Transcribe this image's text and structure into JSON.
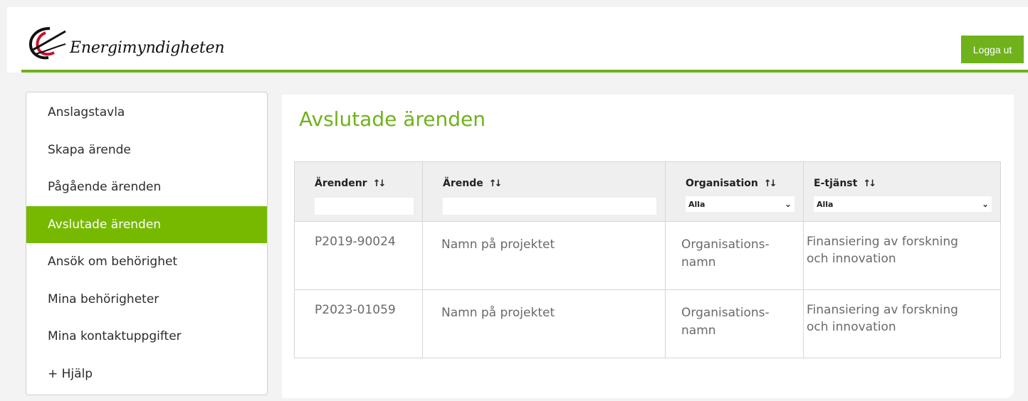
{
  "header": {
    "logo_text": "Energimyndigheten",
    "logout_label": "Logga ut"
  },
  "sidebar": {
    "items": [
      {
        "label": "Anslagstavla"
      },
      {
        "label": "Skapa ärende"
      },
      {
        "label": "Pågående ärenden"
      },
      {
        "label": "Avslutade ärenden",
        "active": true
      },
      {
        "label": "Ansök om behörighet"
      },
      {
        "label": "Mina behörigheter"
      },
      {
        "label": "Mina kontaktuppgifter"
      },
      {
        "label": "+ Hjälp"
      }
    ]
  },
  "main": {
    "title": "Avslutade ärenden",
    "table": {
      "columns": [
        {
          "label": "Ärendenr",
          "filter": ""
        },
        {
          "label": "Ärende",
          "filter": ""
        },
        {
          "label": "Organisation",
          "filter": "Alla"
        },
        {
          "label": "E-tjänst",
          "filter": "Alla"
        }
      ],
      "rows": [
        {
          "nr": "P2019-90024",
          "name": "Namn på projektet",
          "org": "Organisations-namn",
          "tjanst": "Finansiering av forskning och innovation"
        },
        {
          "nr": "P2023-01059",
          "name": "Namn på projektet",
          "org": "Organisations-namn",
          "tjanst": "Finansiering av forskning och innovation"
        }
      ]
    }
  },
  "colors": {
    "accent": "#6fb21b",
    "active_bg": "#76b900"
  }
}
